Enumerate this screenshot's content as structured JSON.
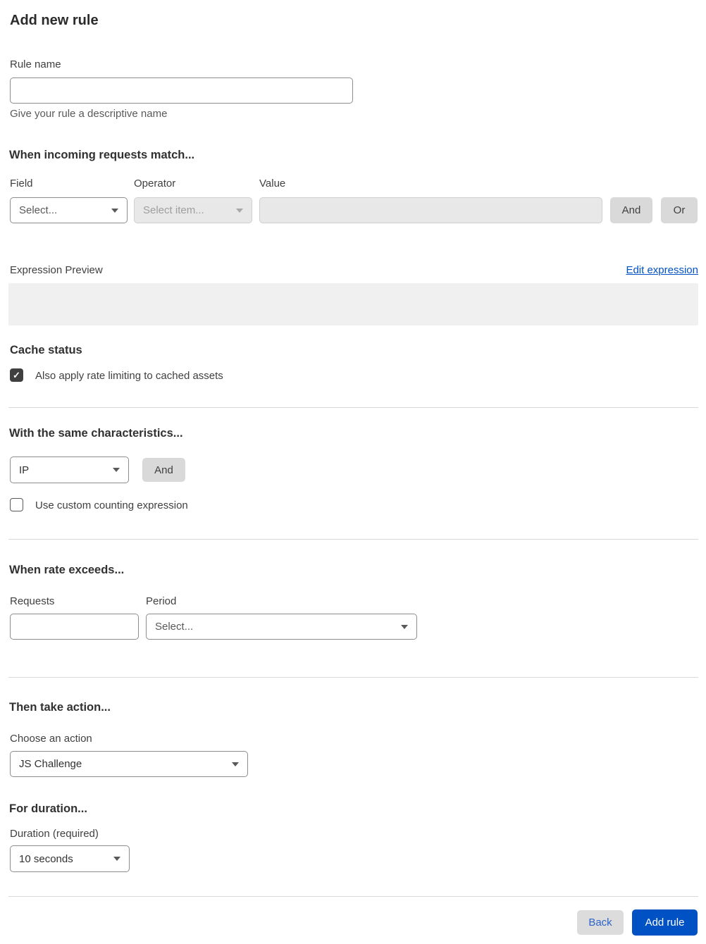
{
  "title": "Add new rule",
  "rule_name": {
    "label": "Rule name",
    "value": "",
    "helper": "Give your rule a descriptive name"
  },
  "match": {
    "heading": "When incoming requests match...",
    "field_label": "Field",
    "field_value": "Select...",
    "operator_label": "Operator",
    "operator_value": "Select item...",
    "value_label": "Value",
    "value_value": "",
    "and_label": "And",
    "or_label": "Or"
  },
  "expression": {
    "label": "Expression Preview",
    "edit_link": "Edit expression",
    "preview": ""
  },
  "cache": {
    "heading": "Cache status",
    "checkbox_label": "Also apply rate limiting to cached assets",
    "checked": true,
    "check_glyph": "✓"
  },
  "characteristics": {
    "heading": "With the same characteristics...",
    "select_value": "IP",
    "and_label": "And",
    "checkbox_label": "Use custom counting expression",
    "checked": false
  },
  "rate": {
    "heading": "When rate exceeds...",
    "requests_label": "Requests",
    "requests_value": "",
    "period_label": "Period",
    "period_value": "Select..."
  },
  "action": {
    "heading": "Then take action...",
    "choose_label": "Choose an action",
    "selected": "JS Challenge"
  },
  "duration": {
    "heading": "For duration...",
    "label": "Duration (required)",
    "selected": "10 seconds"
  },
  "footer": {
    "back_label": "Back",
    "add_label": "Add rule"
  },
  "colors": {
    "primary_blue": "#0051c3",
    "link_blue": "#0051c3",
    "gray_button": "#d9d9d9",
    "disabled_bg": "#e8e8e8",
    "preview_bg": "#f0f0f0",
    "checkbox_checked": "#404040",
    "divider": "#d9d9d9"
  }
}
